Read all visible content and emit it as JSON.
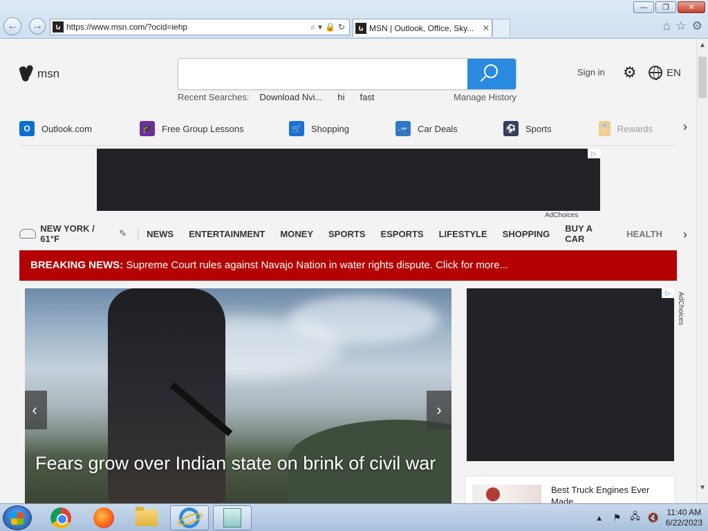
{
  "browser": {
    "url": "https://www.msn.com/?ocid=iehp",
    "tab_title": "MSN | Outlook, Office, Sky...",
    "tab_close": "✕",
    "window_controls": {
      "minimize": "—",
      "maximize": "❐",
      "close": "✕"
    },
    "nav": {
      "back": "←",
      "forward": "→"
    },
    "address_icons": [
      "search-icon",
      "chevron-down-icon",
      "lock-icon",
      "refresh-icon"
    ],
    "tool_icons": [
      "home-icon",
      "favorites-icon",
      "settings-icon"
    ]
  },
  "msn": {
    "logo_text": "msn",
    "search": {
      "value": "",
      "placeholder": ""
    },
    "recent_label": "Recent Searches:",
    "recent_searches": [
      "Download Nvi...",
      "hi",
      "fast"
    ],
    "manage_history": "Manage History",
    "sign_in": "Sign in",
    "settings_icon": "⚙",
    "language": "EN"
  },
  "quick_links": [
    {
      "label": "Outlook.com",
      "icon": "outlook-icon",
      "color": "#0a6fd0",
      "glyph": "O"
    },
    {
      "label": "Free Group Lessons",
      "icon": "graduation-cap-icon",
      "color": "#6b2fa0",
      "glyph": "🎓"
    },
    {
      "label": "Shopping",
      "icon": "shopping-cart-icon",
      "color": "#1b6fd6",
      "glyph": "🛒"
    },
    {
      "label": "Car Deals",
      "icon": "car-icon",
      "color": "#2e79c9",
      "glyph": "🚙"
    },
    {
      "label": "Sports",
      "icon": "sports-ball-icon",
      "color": "#333d5c",
      "glyph": "⚽"
    },
    {
      "label": "Rewards",
      "icon": "rewards-medal-icon",
      "color": "#e8a21a",
      "glyph": "🏅"
    }
  ],
  "ad": {
    "adchoices": "AdChoices"
  },
  "weather": {
    "location": "NEW YORK / 61°F"
  },
  "categories": [
    "NEWS",
    "ENTERTAINMENT",
    "MONEY",
    "SPORTS",
    "ESPORTS",
    "LIFESTYLE",
    "SHOPPING",
    "BUY A CAR",
    "HEALTH"
  ],
  "breaking": {
    "label": "BREAKING NEWS:",
    "text": "Supreme Court rules against Navajo Nation in water rights dispute. Click for more..."
  },
  "hero": {
    "title": "Fears grow over Indian state on brink of civil war"
  },
  "side_card": {
    "title": "Best Truck Engines Ever Made"
  },
  "taskbar": {
    "apps": [
      "chrome-icon",
      "firefox-icon",
      "file-explorer-icon",
      "internet-explorer-icon",
      "notepad-icon"
    ],
    "tray_icons": [
      "show-hidden-icons-icon",
      "action-center-flag-icon",
      "network-icon",
      "volume-muted-icon"
    ],
    "time": "11:40 AM",
    "date": "6/22/2023"
  }
}
